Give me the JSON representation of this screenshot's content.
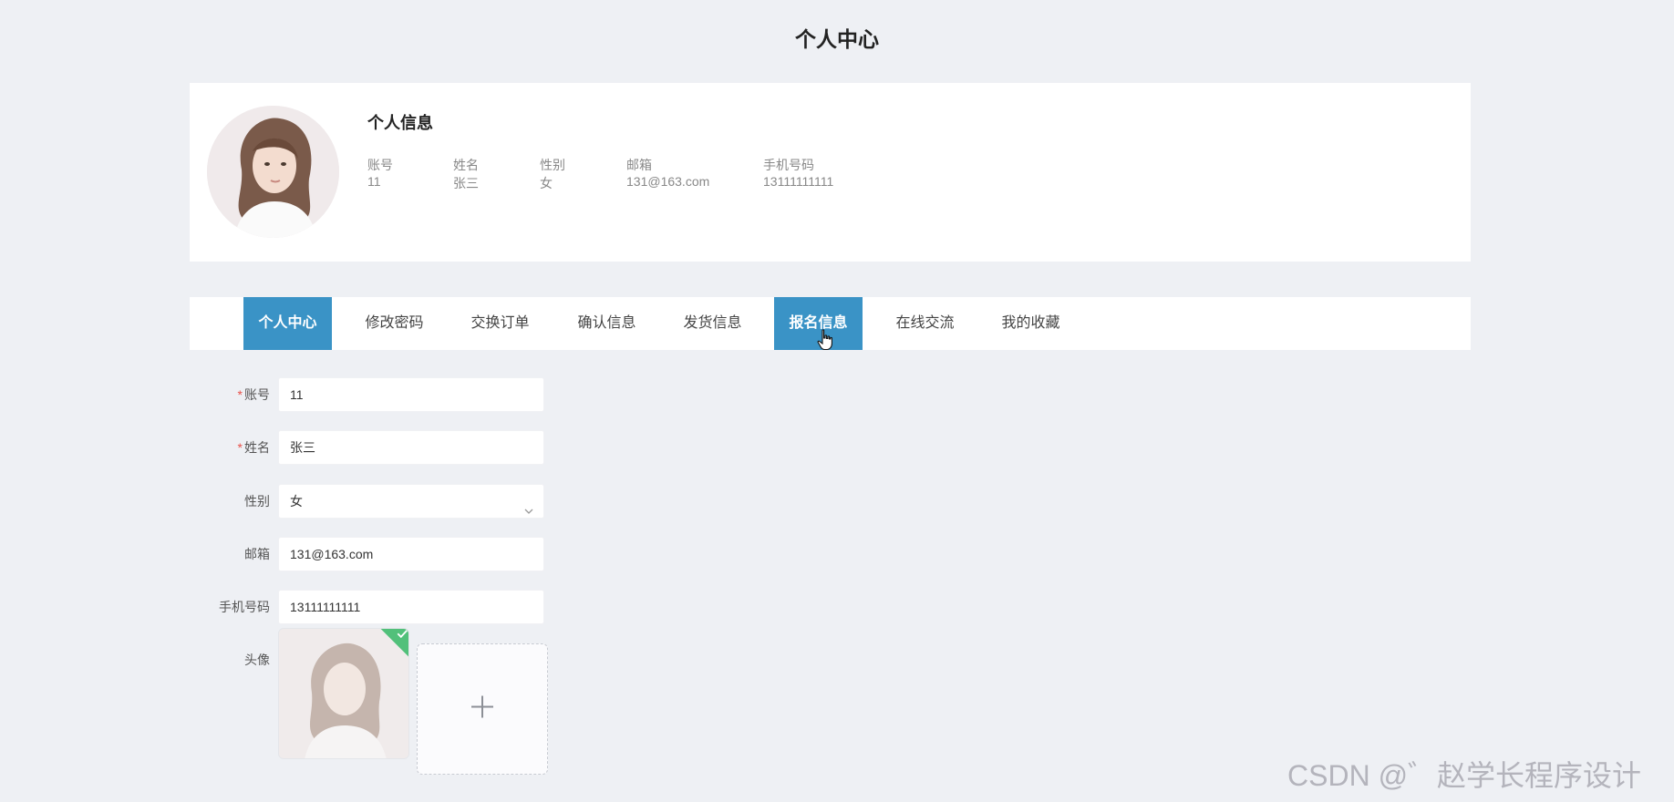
{
  "page": {
    "title": "个人中心"
  },
  "profile": {
    "section_title": "个人信息",
    "fields": [
      {
        "label": "账号",
        "value": "11"
      },
      {
        "label": "姓名",
        "value": "张三"
      },
      {
        "label": "性别",
        "value": "女"
      },
      {
        "label": "邮箱",
        "value": "131@163.com"
      },
      {
        "label": "手机号码",
        "value": "13111111111"
      }
    ]
  },
  "tabs": [
    {
      "label": "个人中心",
      "active": true
    },
    {
      "label": "修改密码",
      "active": false
    },
    {
      "label": "交换订单",
      "active": false
    },
    {
      "label": "确认信息",
      "active": false
    },
    {
      "label": "发货信息",
      "active": false
    },
    {
      "label": "报名信息",
      "active": true
    },
    {
      "label": "在线交流",
      "active": false
    },
    {
      "label": "我的收藏",
      "active": false
    }
  ],
  "form": {
    "required_mark": "*",
    "account": {
      "label": "账号",
      "value": "11",
      "required": true
    },
    "name": {
      "label": "姓名",
      "value": "张三",
      "required": true
    },
    "gender": {
      "label": "性别",
      "value": "女",
      "required": false
    },
    "email": {
      "label": "邮箱",
      "value": "131@163.com",
      "required": false
    },
    "phone": {
      "label": "手机号码",
      "value": "13111111111",
      "required": false
    },
    "avatar": {
      "label": "头像"
    }
  },
  "colors": {
    "accent": "#3a93c6",
    "required": "#e8514a",
    "success": "#52c07a",
    "background": "#eef0f4"
  },
  "watermark": "CSDN @゛赵学长程序设计"
}
